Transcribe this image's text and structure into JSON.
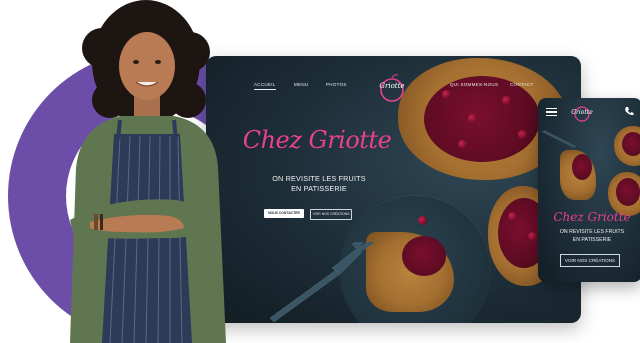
{
  "desktop": {
    "nav": {
      "accueil": "ACCUEIL",
      "menu": "MENU",
      "photos": "PHOTOS",
      "qui_sommes_nous": "QUI SOMMES-NOUS",
      "contact": "CONTACT"
    },
    "logo_text": "Griotte",
    "hero": {
      "title": "Chez Griotte",
      "subtitle_line1": "ON REVISITE LES FRUITS",
      "subtitle_line2": "EN PATISSERIE"
    },
    "buttons": {
      "contact": "NOUS CONTACTER",
      "creations": "VOIR NOS CRÉATIONS"
    }
  },
  "phone": {
    "logo_text": "Griotte",
    "title": "Chez Griotte",
    "subtitle_line1": "ON REVISITE LES FRUITS",
    "subtitle_line2": "EN PATISSERIE",
    "button": "VOIR NOS CRÉATIONS"
  },
  "colors": {
    "accent_pink": "#e8418f",
    "background_dark": "#1c2c36",
    "decor_purple": "#6c4ea8"
  },
  "icons": {
    "menu": "hamburger-menu-icon",
    "phone": "phone-icon"
  }
}
